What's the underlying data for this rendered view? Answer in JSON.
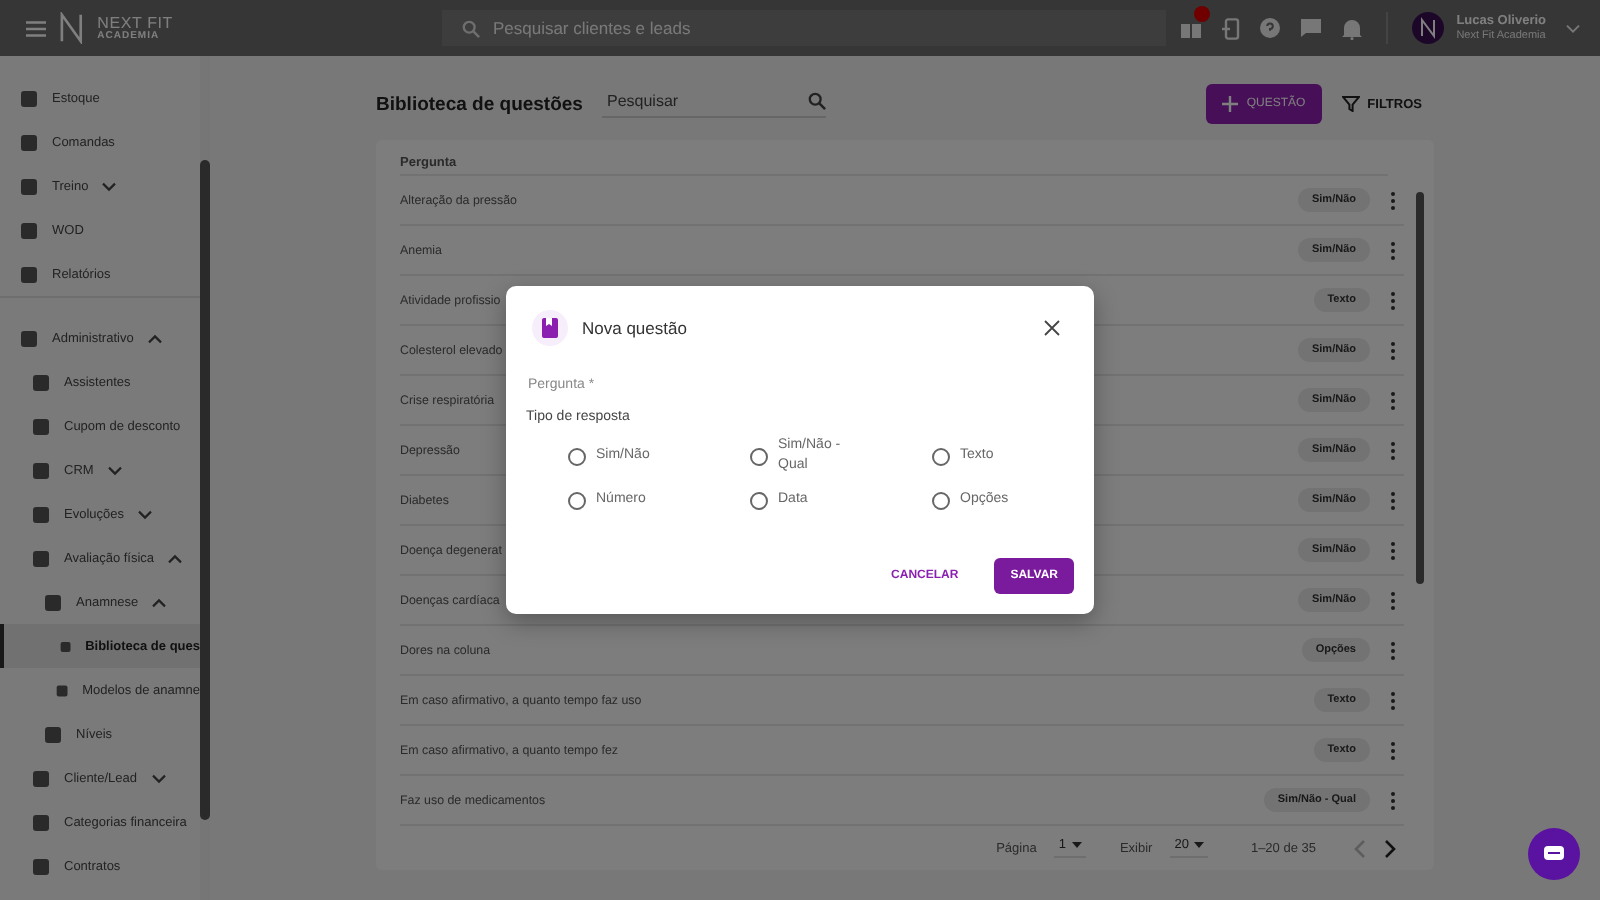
{
  "topbar": {
    "logo": "NEXT FIT",
    "logo_sub": "ACADEMIA",
    "search": {
      "placeholder": "Pesquisar clientes e leads"
    },
    "notification_badge": true,
    "user": {
      "name": "Lucas Oliverio",
      "company": "Next Fit Academia"
    }
  },
  "sidebar": {
    "items": [
      {
        "label": "Estoque",
        "selected": false
      },
      {
        "label": "Comandas",
        "selected": false
      },
      {
        "label": "Treino",
        "selected": false,
        "expanded": false
      },
      {
        "label": "WOD",
        "selected": false
      },
      {
        "label": "Relatórios",
        "selected": false
      },
      {
        "label": "Administrativo",
        "selected": false,
        "expanded": true,
        "children": [
          {
            "label": "Assistentes",
            "selected": false
          },
          {
            "label": "Cupom de desconto",
            "selected": false
          },
          {
            "label": "CRM",
            "selected": false,
            "expanded": false
          },
          {
            "label": "Evoluções",
            "selected": false,
            "expanded": false
          },
          {
            "label": "Avaliação física",
            "selected": false,
            "expanded": true,
            "children": [
              {
                "label": "Anamnese",
                "selected": false,
                "expanded": true,
                "children": [
                  {
                    "label": "Biblioteca de ques",
                    "selected": true
                  },
                  {
                    "label": "Modelos de anamne",
                    "selected": false
                  }
                ]
              },
              {
                "label": "Níveis",
                "selected": false
              }
            ]
          },
          {
            "label": "Cliente/Lead",
            "selected": false,
            "expanded": false
          },
          {
            "label": "Categorias financeira",
            "selected": false
          },
          {
            "label": "Contratos",
            "selected": false
          }
        ]
      }
    ]
  },
  "page": {
    "title": "Biblioteca de questões",
    "search": {
      "placeholder": "Pesquisar"
    },
    "add_button": "QUESTÃO",
    "filter_button": "FILTROS"
  },
  "table": {
    "columns": [
      "Pergunta"
    ],
    "rows": [
      {
        "question": "Alteração da pressão",
        "type": "Sim/Não"
      },
      {
        "question": "Anemia",
        "type": "Sim/Não"
      },
      {
        "question": "Atividade profissio",
        "type": "Texto"
      },
      {
        "question": "Colesterol elevado",
        "type": "Sim/Não"
      },
      {
        "question": "Crise respiratória",
        "type": "Sim/Não"
      },
      {
        "question": "Depressão",
        "type": "Sim/Não"
      },
      {
        "question": "Diabetes",
        "type": "Sim/Não"
      },
      {
        "question": "Doença degenerat",
        "type": "Sim/Não"
      },
      {
        "question": "Doenças cardíaca",
        "type": "Sim/Não"
      },
      {
        "question": "Dores na coluna",
        "type": "Opções"
      },
      {
        "question": "Em caso afirmativo, a quanto tempo faz uso",
        "type": "Texto"
      },
      {
        "question": "Em caso afirmativo, a quanto tempo fez",
        "type": "Texto"
      },
      {
        "question": "Faz uso de medicamentos",
        "type": "Sim/Não - Qual"
      }
    ]
  },
  "pagination": {
    "page_label": "Página",
    "page": "1",
    "show_label": "Exibir",
    "page_size": "20",
    "range": "1–20 de 35",
    "prev_disabled": true,
    "next_disabled": false
  },
  "dialog": {
    "title": "Nova questão",
    "field": {
      "placeholder": "Pergunta *"
    },
    "answer_type_label": "Tipo de resposta",
    "options": [
      {
        "label": "Sim/Não",
        "selected": false
      },
      {
        "label": "Sim/Não - Qual",
        "selected": false
      },
      {
        "label": "Texto",
        "selected": false
      },
      {
        "label": "Número",
        "selected": false
      },
      {
        "label": "Data",
        "selected": false
      },
      {
        "label": "Opções",
        "selected": false
      }
    ],
    "cancel": "CANCELAR",
    "save": "SALVAR"
  }
}
